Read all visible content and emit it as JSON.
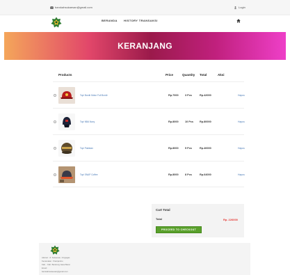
{
  "topbar": {
    "email": "barokahsukaesan@gmail.com",
    "login_label": "Login"
  },
  "nav": {
    "beranda": "BERANDA",
    "history": "HISTORY TRANSAKSI"
  },
  "banner": {
    "title": "KERANJANG"
  },
  "table": {
    "headers": {
      "products": "Products",
      "price": "Price",
      "quantity": "Quantity",
      "total": "Total",
      "aksi": "Aksi"
    },
    "rows": [
      {
        "name": "Topi Bordir Motor Full Bordir",
        "price": "Rp.7000",
        "qty": "3 Pcs",
        "total": "Rp.42000",
        "action": "Hapus"
      },
      {
        "name": "Topi NBA Navy",
        "price": "Rp.8000",
        "qty": "10 Pcs",
        "total": "Rp.80000",
        "action": "Hapus"
      },
      {
        "name": "Topi Pakistan",
        "price": "Rp.8000",
        "qty": "5 Pcs",
        "total": "Rp.40000",
        "action": "Hapus"
      },
      {
        "name": "Topi SNAP Coffee",
        "price": "Rp.8000",
        "qty": "8 Pcs",
        "total": "Rp.64000",
        "action": "Hapus"
      }
    ]
  },
  "cart_total": {
    "title": "Cart Total",
    "total_label": "Total",
    "total_value": "Rp. 226000",
    "checkout_label": "PROCEED TO CHECKOUT"
  },
  "footer": {
    "lines": [
      "Alamat : Jl. Sukaesan, Cingagas",
      "Kecamatan : Pasirjambu",
      "Kab. : Kab. Bandung Jawa Barat",
      "Email :",
      "barokahsukaesan@gmail.com"
    ]
  },
  "colors": {
    "accent_green": "#5aa02c",
    "link_blue": "#4a7bb7",
    "total_red": "#e53935"
  }
}
